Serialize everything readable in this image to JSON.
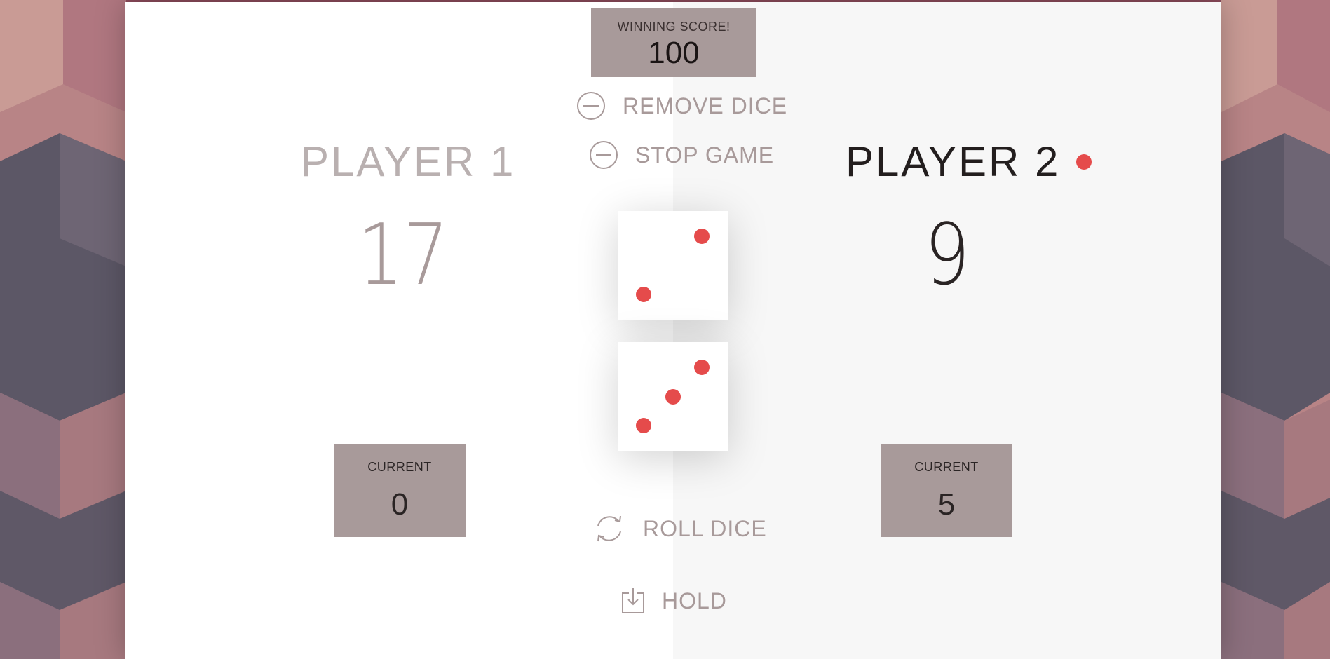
{
  "winning_score": {
    "label": "WINNING SCORE!",
    "value": "100"
  },
  "controls": {
    "remove_dice": "REMOVE DICE",
    "stop_game": "STOP GAME",
    "roll_dice": "ROLL DICE",
    "hold": "HOLD"
  },
  "players": [
    {
      "name": "PLAYER 1",
      "score": "17",
      "current_label": "CURRENT",
      "current": "0",
      "active": false
    },
    {
      "name": "PLAYER 2",
      "score": "9",
      "current_label": "CURRENT",
      "current": "5",
      "active": true
    }
  ],
  "dice": [
    {
      "value": 2
    },
    {
      "value": 3
    }
  ],
  "colors": {
    "accent": "#e54b4b",
    "box": "#a89a9a",
    "muted_text": "#a89a9a",
    "active_text": "#231e1e"
  }
}
